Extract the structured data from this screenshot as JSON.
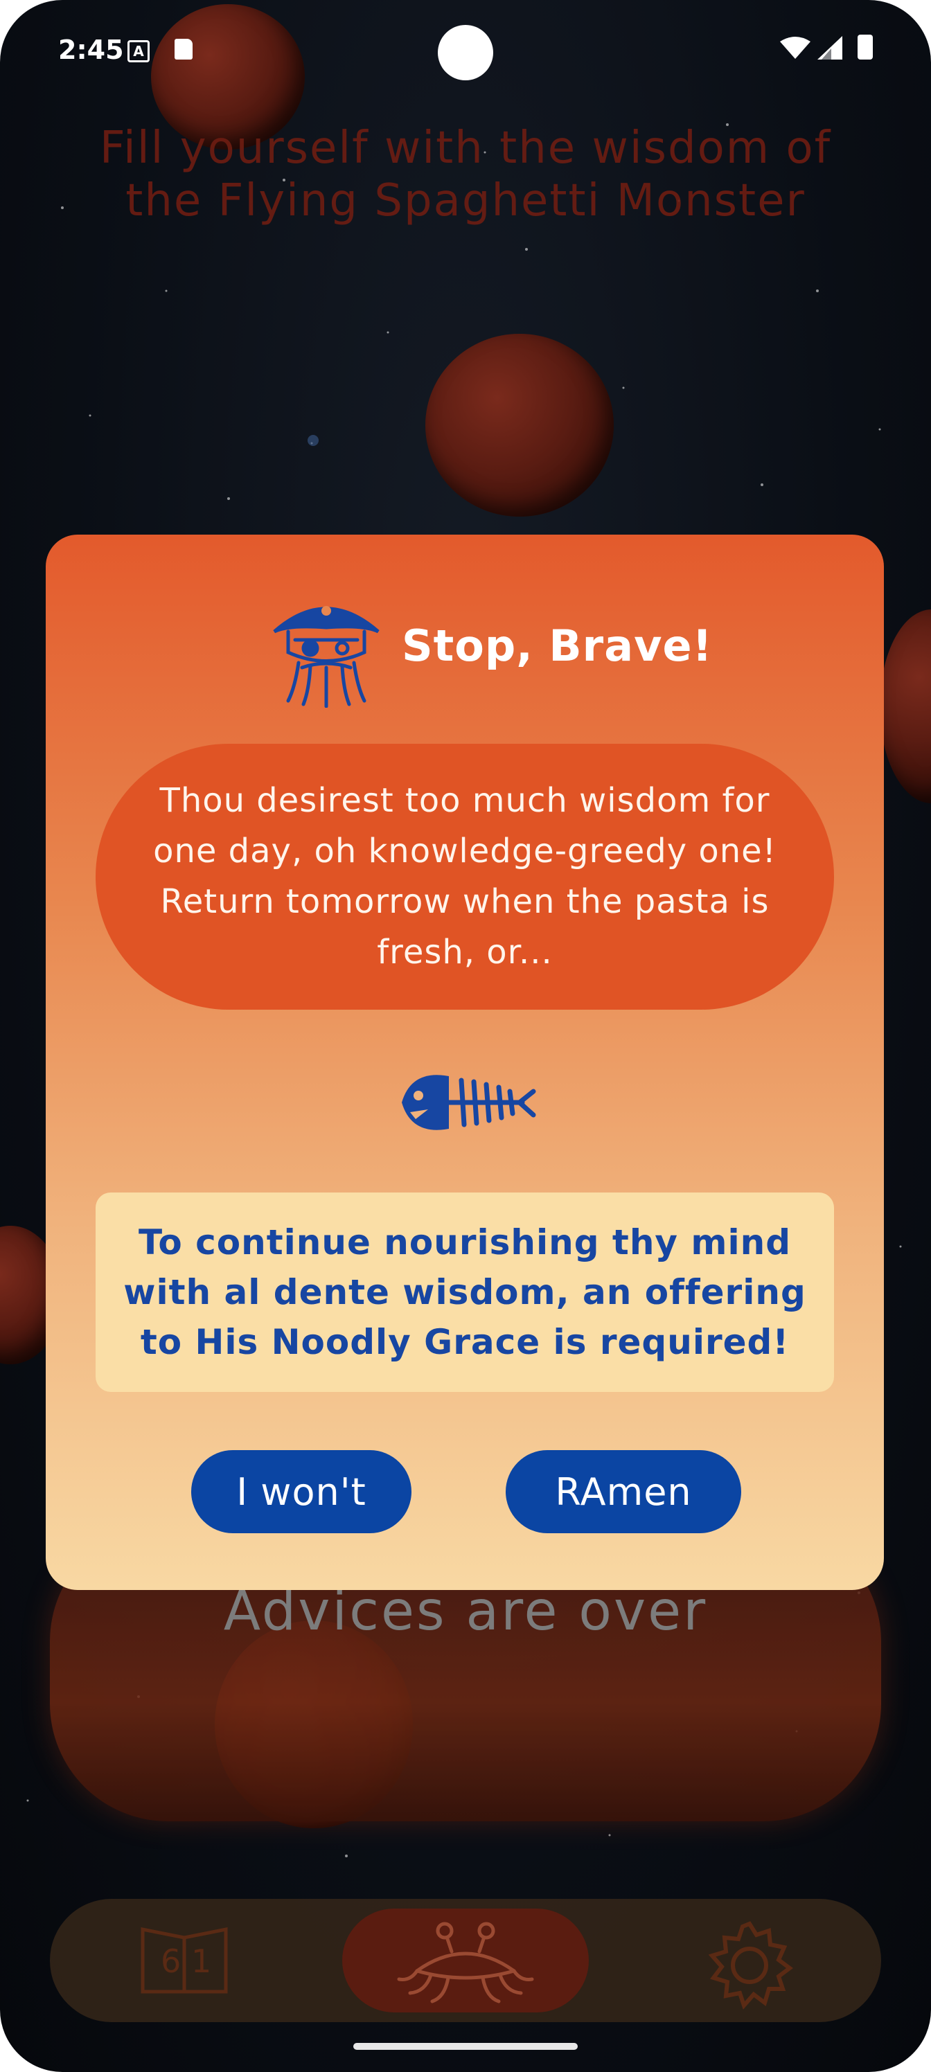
{
  "status_bar": {
    "time": "2:45",
    "notification_icon_letter": "A",
    "icons": [
      "a-notification-icon",
      "sd-card-icon",
      "wifi-icon",
      "signal-icon",
      "battery-icon"
    ]
  },
  "background": {
    "header_text": "Fill yourself with the wisdom of the Flying Spaghetti Monster",
    "advice_text": "Advices are over"
  },
  "dialog": {
    "title": "Stop, Brave!",
    "title_icon": "pirate-icon",
    "message": "Thou desirest too much wisdom for one day, oh knowledge-greedy one! Return tomorrow when the pasta is fresh, or...",
    "divider_icon": "fish-skeleton-icon",
    "offer_text": "To continue nourishing thy mind with al dente wisdom, an offering to His Noodly Grace is required!",
    "buttons": {
      "decline_label": "I won't",
      "accept_label": "RAmen"
    }
  },
  "bottom_nav": {
    "items": [
      {
        "icon": "book-icon",
        "active": false
      },
      {
        "icon": "flying-spaghetti-monster-icon",
        "active": true
      },
      {
        "icon": "gear-icon",
        "active": false
      }
    ]
  },
  "colors": {
    "dialog_top": "#e35a2c",
    "dialog_bottom": "#f8d8a3",
    "bubble": "#e05425",
    "offer_box": "#fadea6",
    "button": "#0b45a3",
    "offer_text": "#1746a2",
    "header_text": "#6e1d12"
  }
}
